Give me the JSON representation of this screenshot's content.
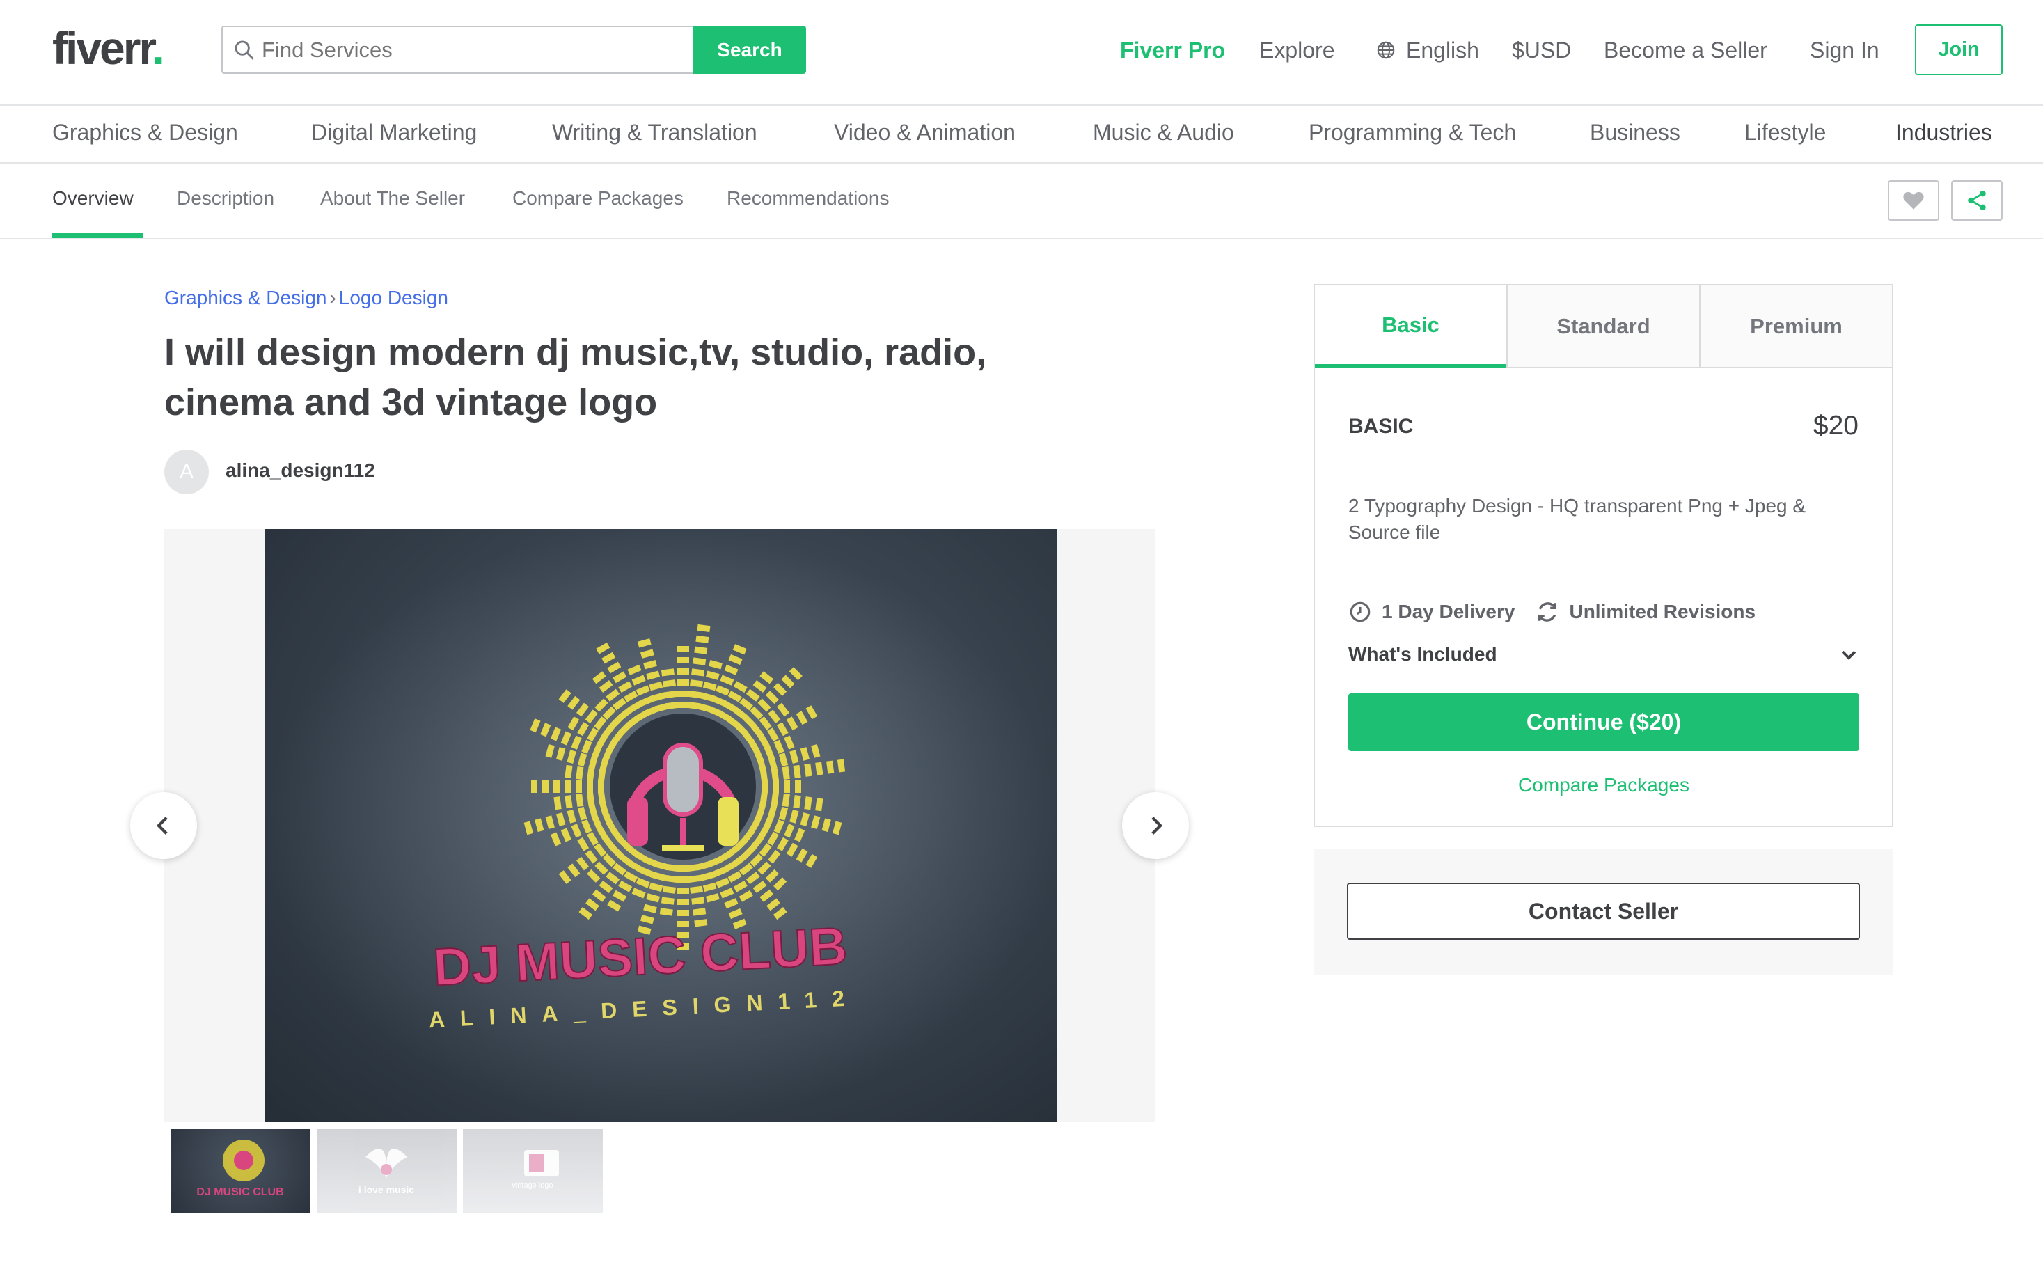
{
  "header": {
    "logo_text": "fiverr",
    "logo_dot": ".",
    "search_placeholder": "Find Services",
    "search_button": "Search",
    "nav": {
      "pro": "Fiverr Pro",
      "explore": "Explore",
      "language": "English",
      "currency": "$USD",
      "become_seller": "Become a Seller",
      "sign_in": "Sign In",
      "join": "Join"
    }
  },
  "categories": [
    "Graphics & Design",
    "Digital Marketing",
    "Writing & Translation",
    "Video & Animation",
    "Music & Audio",
    "Programming & Tech",
    "Business",
    "Lifestyle",
    "Industries"
  ],
  "subnav": {
    "tabs": [
      "Overview",
      "Description",
      "About The Seller",
      "Compare Packages",
      "Recommendations"
    ],
    "active": "Overview"
  },
  "gig": {
    "breadcrumb": [
      "Graphics & Design",
      "Logo Design"
    ],
    "breadcrumb_sep": "›",
    "title": "I will design modern dj music,tv, studio, radio, cinema and 3d vintage logo",
    "seller_initial": "A",
    "seller_name": "alina_design112",
    "image": {
      "logo_title": "DJ MUSIC CLUB",
      "logo_subtitle": "ALINA_DESIGN112"
    },
    "thumbnails": [
      {
        "caption": "DJ MUSIC CLUB"
      },
      {
        "caption": "i love music"
      },
      {
        "caption": "vintage logo"
      }
    ]
  },
  "package": {
    "tabs": [
      "Basic",
      "Standard",
      "Premium"
    ],
    "active_tab": "Basic",
    "name": "BASIC",
    "price": "$20",
    "description": "2 Typography Design - HQ transparent Png + Jpeg & Source file",
    "delivery": "1 Day Delivery",
    "revisions": "Unlimited Revisions",
    "included_label": "What's Included",
    "continue_button": "Continue ($20)",
    "compare_link": "Compare Packages"
  },
  "contact": {
    "button": "Contact Seller"
  },
  "colors": {
    "brand_green": "#1dbf73",
    "link_blue": "#446ee7",
    "text_dark": "#404145",
    "text_gray": "#62646a"
  }
}
